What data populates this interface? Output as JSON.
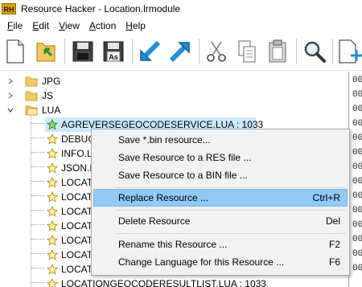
{
  "window": {
    "title": "Resource Hacker - Location.lrmodule",
    "icon_text": "RH"
  },
  "menu": [
    {
      "label": "File",
      "key": "F",
      "rest": "ile"
    },
    {
      "label": "Edit",
      "key": "E",
      "rest": "dit"
    },
    {
      "label": "View",
      "key": "V",
      "rest": "iew"
    },
    {
      "label": "Action",
      "key": "A",
      "rest": "ction"
    },
    {
      "label": "Help",
      "key": "H",
      "rest": "elp"
    }
  ],
  "toolbar": {
    "buttons": [
      "new-file-icon",
      "open-folder-icon",
      "save-icon",
      "save-as-icon",
      "compile-arrow-icon",
      "run-arrow-icon",
      "cut-icon",
      "copy-icon",
      "paste-icon",
      "find-icon",
      "add-resource-icon"
    ],
    "save_as_badge": "As"
  },
  "tree": {
    "folders": [
      {
        "label": "JPG",
        "expanded": false
      },
      {
        "label": "JS",
        "expanded": false
      },
      {
        "label": "LUA",
        "expanded": true
      }
    ],
    "items": [
      {
        "label": "AGREVERSEGEOCODESERVICE.LUA : 1033",
        "selected": true
      },
      {
        "label": "DEBUG"
      },
      {
        "label": "INFO.L"
      },
      {
        "label": "JSON.L"
      },
      {
        "label": "LOCAT"
      },
      {
        "label": "LOCAT"
      },
      {
        "label": "LOCAT"
      },
      {
        "label": "LOCAT"
      },
      {
        "label": "LOCAT"
      },
      {
        "label": "LOCAT"
      },
      {
        "label": "LOCAT"
      },
      {
        "label": "LOCATIONGEOCODERESULTLIST.LUA : 1033"
      }
    ]
  },
  "hex_pane": {
    "lines": [
      "00",
      "00",
      "00",
      "00",
      "00",
      "00",
      "00",
      "00",
      "00",
      "00",
      "00",
      "00",
      "00",
      "00"
    ]
  },
  "context_menu": {
    "items": [
      {
        "label": "Save *.bin resource...",
        "shortcut": ""
      },
      {
        "label": "Save Resource to a RES file ...",
        "shortcut": ""
      },
      {
        "label": "Save Resource to a BIN file ...",
        "shortcut": ""
      },
      {
        "label": "Replace Resource ...",
        "shortcut": "Ctrl+R",
        "highlighted": true
      },
      {
        "label": "Delete Resource",
        "shortcut": "Del"
      },
      {
        "label": "Rename this Resource ...",
        "shortcut": "F2"
      },
      {
        "label": "Change Language for this Resource ...",
        "shortcut": "F6"
      }
    ]
  },
  "colors": {
    "selection": "#cce8ff",
    "menu_highlight": "#91c9f7",
    "toolbar_blue": "#1e8fd8",
    "folder": "#f2c75c"
  }
}
